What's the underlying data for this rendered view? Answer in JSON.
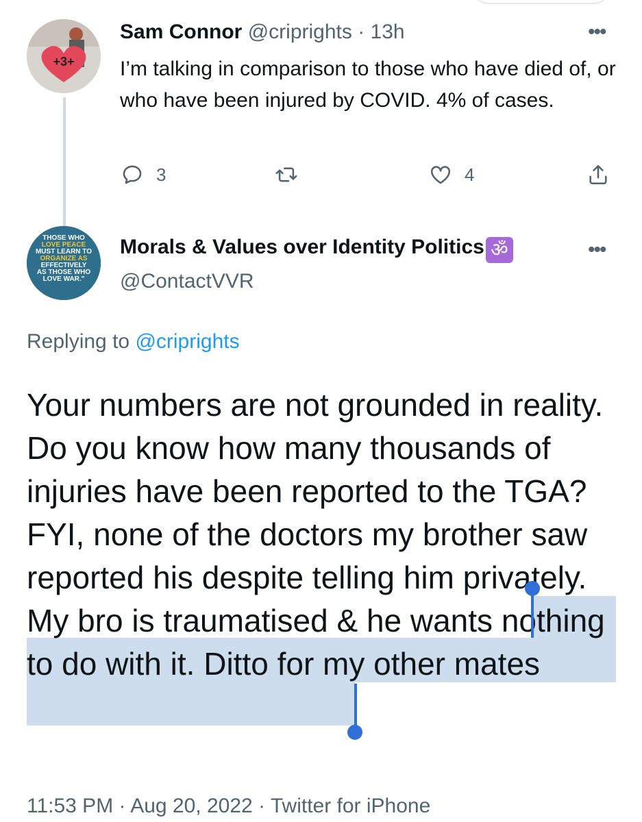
{
  "tweet1": {
    "name": "Sam Connor",
    "handle": "@criprights",
    "sep": "·",
    "time": "13h",
    "text": "I’m talking in comparison to those who have died of, or who have been injured by COVID. 4% of cases.",
    "avatar_text": "+3+",
    "actions": {
      "replies": "3",
      "retweets": "",
      "likes": "4"
    }
  },
  "tweet2": {
    "name": "Morals & Values over Identity Politics",
    "name_emoji": "ॐ",
    "handle": "@ContactVVR",
    "avatar_lines": [
      "THOSE WHO",
      "LOVE PEACE",
      "MUST LEARN TO",
      "ORGANIZE AS",
      "EFFECTIVELY",
      "AS THOSE WHO",
      "LOVE WAR.\""
    ],
    "replying_label": "Replying to",
    "replying_handle": "@criprights",
    "text_before": "Your numbers are not grounded in reality. Do you know how many thousands of injuries have been reported to the TGA? FYI, none of the doctors my brother saw reported his despite telling him privately. ",
    "text_selected": "My bro is traumatised & he wants nothing to do with it.",
    "text_after": " Ditto for my other mates",
    "meta": {
      "time": "11:53 PM",
      "date": "Aug 20, 2022",
      "source": "Twitter for iPhone",
      "sep": "·"
    }
  },
  "colors": {
    "accent": "#1d9bf0",
    "muted": "#536471",
    "selection": "#cedded",
    "caret": "#2f6fd8"
  }
}
